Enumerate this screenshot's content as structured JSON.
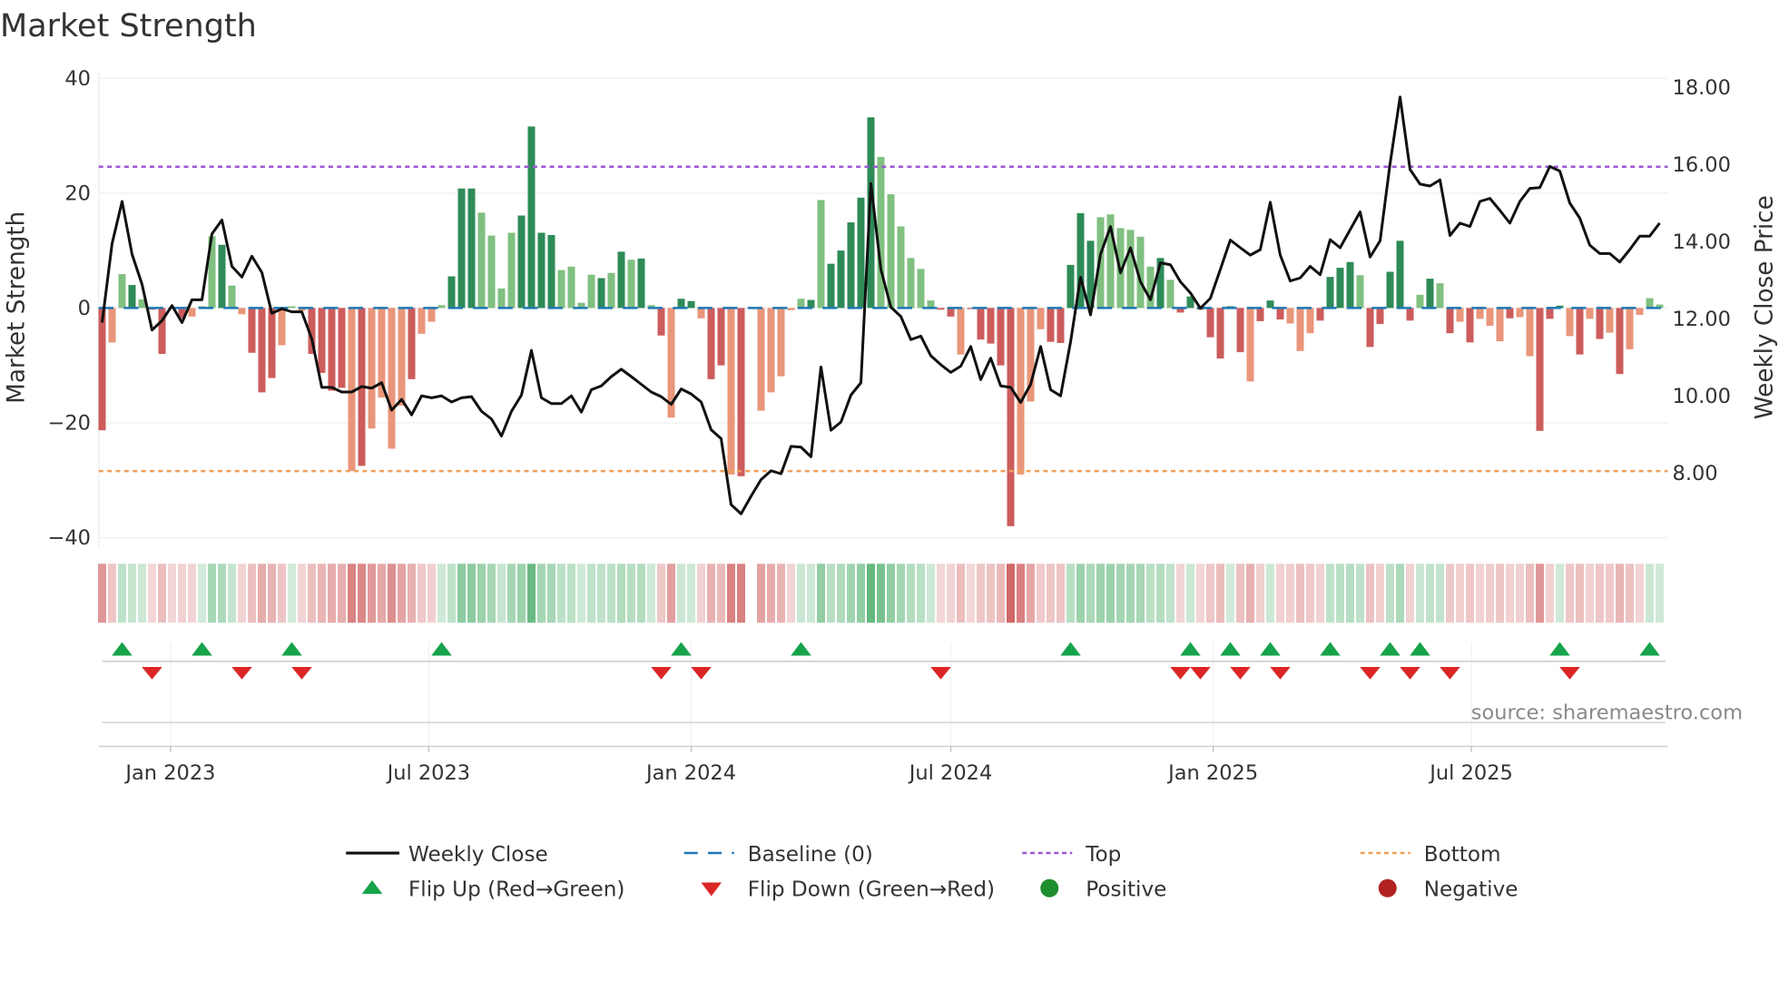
{
  "chart_data": {
    "type": "bar",
    "title": "Market Strength",
    "ylabel": "Market Strength",
    "y2label": "Weekly Close Price",
    "source": "source: sharemaestro.com",
    "start_date": "2022-11-14",
    "interval": "weekly",
    "ylim": [
      -40,
      40
    ],
    "y2lim": [
      6.32,
      18.24
    ],
    "y_ticks": [
      40,
      20,
      0,
      -20,
      -40
    ],
    "y_tick_labels": [
      "40",
      "20",
      "0",
      "−20",
      "−40"
    ],
    "y2_ticks": [
      18,
      16,
      14,
      12,
      10,
      8
    ],
    "y2_tick_labels": [
      "18.00",
      "16.00",
      "14.00",
      "12.00",
      "10.00",
      "8.00"
    ],
    "x_ticks": [
      "2023-01-01",
      "2023-07-01",
      "2024-01-01",
      "2024-07-01",
      "2025-01-01",
      "2025-07-01"
    ],
    "x_tick_labels": [
      "Jan 2023",
      "Jul 2023",
      "Jan 2024",
      "Jul 2024",
      "Jan 2025",
      "Jul 2025"
    ],
    "grid": true,
    "top_level": 24.6,
    "bottom_level": -28.4,
    "baseline": 0,
    "strength": [
      -21.3,
      -6,
      5.9,
      4,
      1.5,
      -0.3,
      -8,
      -0.2,
      -1.8,
      -1.5,
      0.3,
      12.5,
      11,
      3.9,
      -1.1,
      -7.8,
      -14.7,
      -12.2,
      -6.5,
      0.3,
      -0.5,
      -8,
      -11.3,
      -14.4,
      -13.9,
      -28.4,
      -27.5,
      -21,
      -15.6,
      -24.5,
      -17,
      -12.4,
      -4.5,
      -2.4,
      0.5,
      5.5,
      20.8,
      20.8,
      16.6,
      12.6,
      3.4,
      13.1,
      16.1,
      31.6,
      13.1,
      12.7,
      6.6,
      7.2,
      0.9,
      5.8,
      5.2,
      6.1,
      9.8,
      8.4,
      8.6,
      0.5,
      -4.8,
      -19.1,
      1.6,
      1.2,
      -1.8,
      -12.4,
      -10,
      -29,
      -29.3,
      0,
      -17.9,
      -14.7,
      -11.9,
      -0.4,
      1.6,
      1.4,
      18.8,
      7.7,
      10,
      14.9,
      19.2,
      33.2,
      26.3,
      19.8,
      14.2,
      8.7,
      6.8,
      1.3,
      -0.3,
      -1.5,
      -8.1,
      -0.2,
      -5.5,
      -6.2,
      -10,
      -38,
      -29,
      -16.3,
      -3.7,
      -5.9,
      -6.1,
      7.5,
      16.5,
      11.7,
      15.8,
      16.3,
      13.9,
      13.6,
      12.4,
      7.2,
      8.7,
      4.9,
      -0.8,
      2,
      -0.3,
      -5.1,
      -8.8,
      0.3,
      -7.7,
      -12.8,
      -2.3,
      1.3,
      -2,
      -2.7,
      -7.5,
      -4.4,
      -2.2,
      5.4,
      7,
      8,
      5.7,
      -6.8,
      -2.8,
      6.3,
      11.7,
      -2.2,
      2.3,
      5.1,
      4.3,
      -4.4,
      -2.4,
      -6,
      -1.9,
      -3.1,
      -5.8,
      -1.8,
      -1.6,
      -8.4,
      -21.4,
      -1.9,
      0.4,
      -4.9,
      -8.1,
      -1.9,
      -5.4,
      -4.3,
      -11.5,
      -7.2,
      -1.2,
      1.7,
      0.6
    ],
    "shade": "dlldlddldllldlldddlllddddldlllldllldddllllddddlllldldldldlddlddldlllllldldddddllllllddldddddllldddddlllllldldddddddldddlllddddldddddldldldllldlldddldldldl",
    "weekly_close": [
      11.9,
      13.95,
      15.04,
      13.67,
      12.89,
      11.71,
      11.95,
      12.34,
      11.9,
      12.49,
      12.49,
      14.2,
      14.56,
      13.36,
      13.08,
      13.62,
      13.2,
      12.14,
      12.26,
      12.18,
      12.18,
      11.48,
      10.22,
      10.22,
      10.1,
      10.1,
      10.24,
      10.2,
      10.34,
      9.63,
      9.91,
      9.51,
      10.0,
      9.95,
      10.0,
      9.84,
      9.95,
      9.98,
      9.6,
      9.4,
      8.96,
      9.6,
      10.02,
      11.18,
      9.95,
      9.8,
      9.8,
      10.0,
      9.58,
      10.16,
      10.26,
      10.5,
      10.69,
      10.5,
      10.3,
      10.1,
      9.98,
      9.78,
      10.18,
      10.05,
      9.84,
      9.12,
      8.89,
      7.18,
      6.94,
      7.4,
      7.83,
      8.06,
      7.98,
      8.69,
      8.67,
      8.42,
      10.75,
      9.11,
      9.32,
      10.02,
      10.34,
      15.51,
      13.28,
      12.3,
      12.06,
      11.46,
      11.55,
      11.04,
      10.81,
      10.61,
      10.77,
      11.28,
      10.42,
      10.98,
      10.26,
      10.22,
      9.83,
      10.3,
      11.28,
      10.16,
      10.0,
      11.4,
      13.08,
      12.1,
      13.67,
      14.39,
      13.19,
      13.84,
      12.96,
      12.49,
      13.45,
      13.4,
      12.96,
      12.67,
      12.27,
      12.53,
      13.28,
      14.04,
      13.84,
      13.65,
      13.79,
      15.02,
      13.65,
      12.98,
      13.06,
      13.36,
      13.14,
      14.05,
      13.84,
      14.31,
      14.77,
      13.6,
      14.02,
      16.02,
      17.75,
      15.87,
      15.49,
      15.44,
      15.6,
      14.16,
      14.48,
      14.39,
      15.04,
      15.12,
      14.81,
      14.48,
      15.04,
      15.38,
      15.4,
      15.95,
      15.83,
      15.0,
      14.61,
      13.91,
      13.69,
      13.69,
      13.47,
      13.79,
      14.14,
      14.14,
      14.48
    ],
    "flip_up_weeks": [
      2,
      10,
      19,
      34,
      58,
      70,
      97,
      109,
      113,
      117,
      123,
      129,
      132,
      146,
      155
    ],
    "flip_down_weeks": [
      5,
      14,
      20,
      56,
      60,
      84,
      108,
      110,
      114,
      118,
      127,
      131,
      135,
      147
    ],
    "legend": {
      "placement": "bottom",
      "entries": [
        {
          "label": "Weekly Close",
          "kind": "line"
        },
        {
          "label": "Baseline (0)",
          "kind": "dashed"
        },
        {
          "label": "Top",
          "kind": "dotted"
        },
        {
          "label": "Bottom",
          "kind": "dotted"
        },
        {
          "label": "Flip Up (Red→Green)",
          "kind": "triangle-up"
        },
        {
          "label": "Flip Down (Green→Red)",
          "kind": "triangle-down"
        },
        {
          "label": "Positive",
          "kind": "circle"
        },
        {
          "label": "Negative",
          "kind": "circle"
        }
      ]
    },
    "colors": {
      "pos_dark": "#2e8b57",
      "pos_light": "#80c080",
      "neg_dark": "#cd5c5c",
      "neg_light": "#e9967a",
      "close": "#111111",
      "baseline": "#1f77b4",
      "top": "#9b59d6",
      "bottom": "#f0a05a",
      "flip_up": "#16a34a",
      "flip_down": "#dc2626",
      "positive": "#1e8e2e",
      "negative": "#b22222"
    }
  }
}
